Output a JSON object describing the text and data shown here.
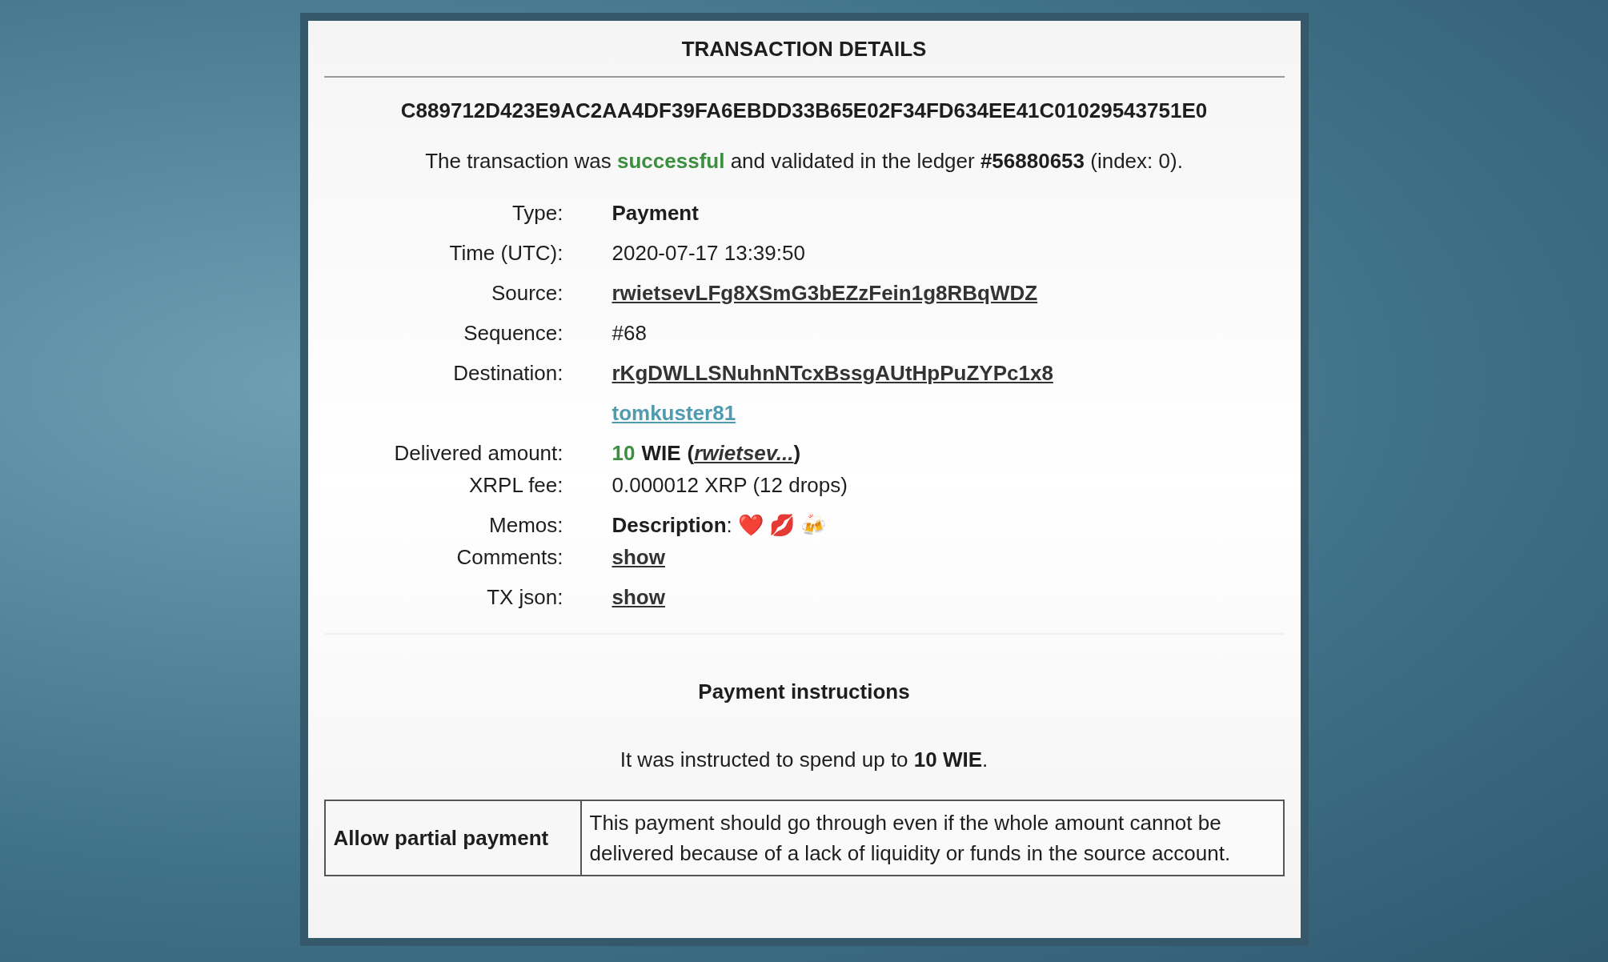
{
  "title": "TRANSACTION DETAILS",
  "hash": "C889712D423E9AC2AA4DF39FA6EBDD33B65E02F34FD634EE41C01029543751E0",
  "status": {
    "before": "The transaction was ",
    "result": "successful",
    "middle": " and validated in the ledger ",
    "ledger": "#56880653",
    "after": " (index: 0)."
  },
  "rows": [
    {
      "kind": "bold",
      "label": "Type:",
      "value": "Payment"
    },
    {
      "kind": "text",
      "label": "Time (UTC):",
      "value": "2020-07-17 13:39:50"
    },
    {
      "kind": "link",
      "label": "Source:",
      "value": "rwietsevLFg8XSmG3bEZzFein1g8RBqWDZ"
    },
    {
      "kind": "text",
      "label": "Sequence:",
      "value": "#68"
    },
    {
      "kind": "link",
      "label": "Destination:",
      "value": "rKgDWLLSNuhnNTcxBssgAUtHpPuZYPc1x8"
    },
    {
      "kind": "handle",
      "value": "tomkuster81"
    },
    {
      "kind": "amount",
      "label": "Delivered amount:",
      "amount": "10",
      "currency": "WIE",
      "open": "(",
      "issuer": "rwietsev...",
      "close": ")"
    },
    {
      "kind": "text",
      "label": "XRPL fee:",
      "value": "0.000012 XRP (12 drops)"
    },
    {
      "kind": "memo",
      "label": "Memos:",
      "value": "**Description**: ❤️ 💋 🍻"
    },
    {
      "kind": "link",
      "label": "Comments:",
      "value": "show"
    },
    {
      "kind": "link",
      "label": "TX json:",
      "value": "show"
    }
  ],
  "instructions": {
    "heading": "Payment instructions",
    "text": "It was instructed to spend up to **10 WIE**.",
    "table": [
      {
        "flag": "Allow partial payment",
        "description": "This payment should go through even if the whole amount cannot be delivered because of a lack of liquidity or funds in the source account."
      }
    ]
  }
}
